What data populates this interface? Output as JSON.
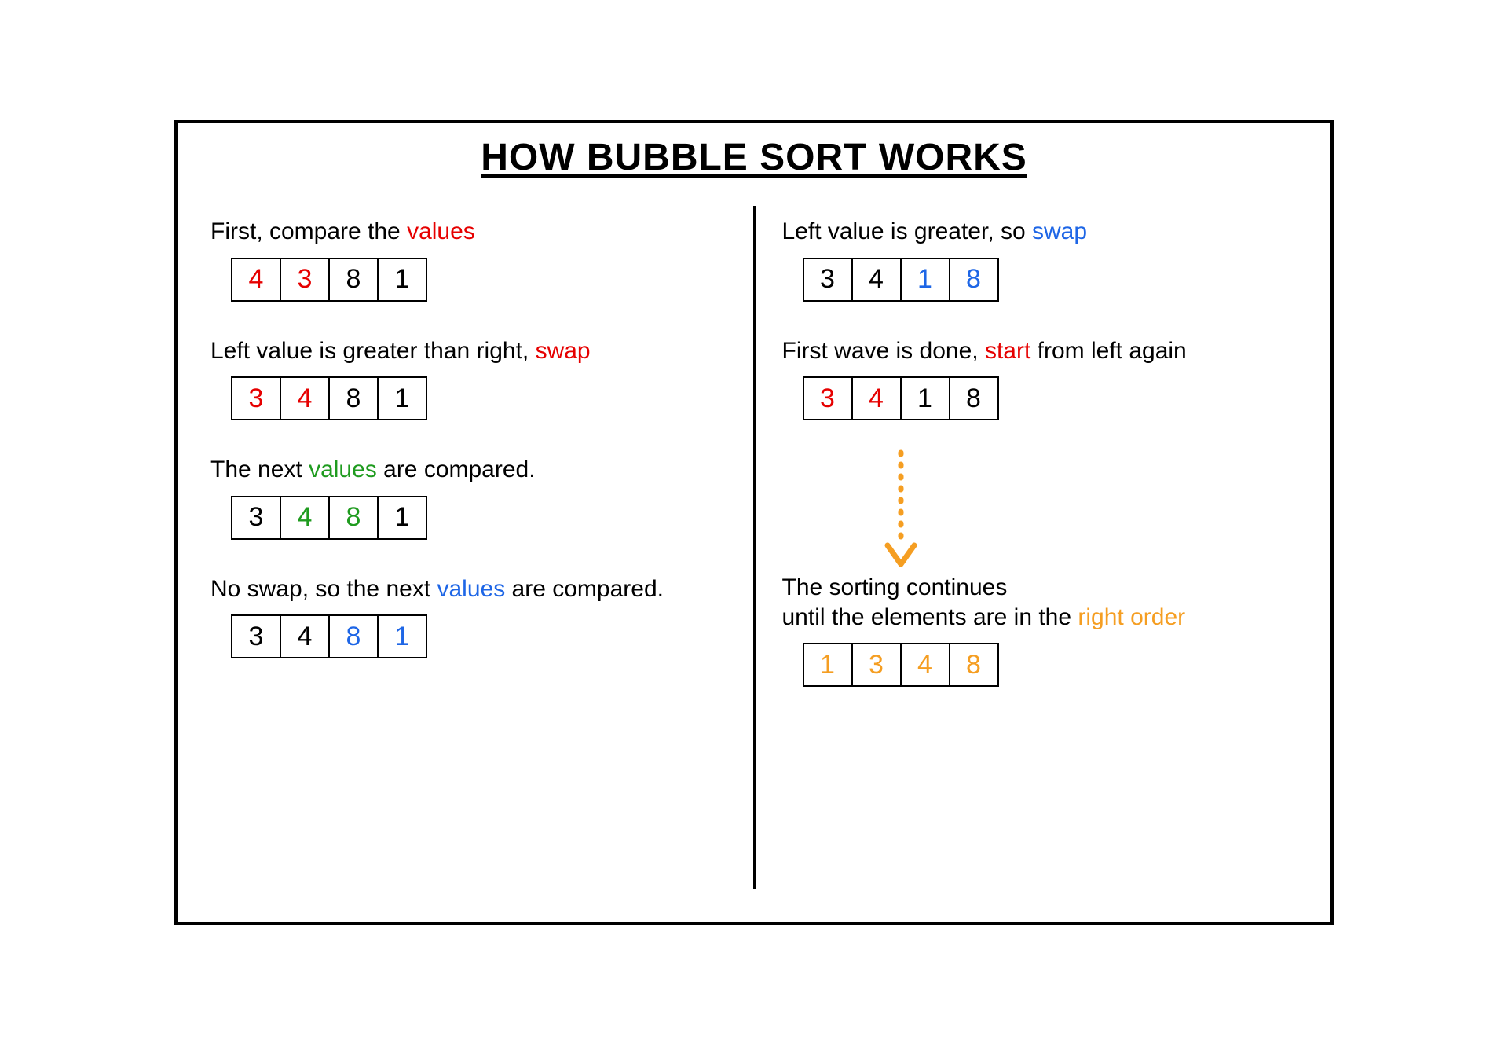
{
  "title": "HOW BUBBLE SORT WORKS",
  "colors": {
    "red": "#e60000",
    "green": "#1f9b1f",
    "blue": "#1e66e6",
    "orange": "#f59e22"
  },
  "left": [
    {
      "id": "step1",
      "caption": [
        {
          "text": "First, compare the "
        },
        {
          "text": "values",
          "color": "red"
        }
      ],
      "cells": [
        {
          "v": "4",
          "color": "red"
        },
        {
          "v": "3",
          "color": "red"
        },
        {
          "v": "8"
        },
        {
          "v": "1"
        }
      ]
    },
    {
      "id": "step2",
      "caption": [
        {
          "text": "Left value is greater than right, "
        },
        {
          "text": "swap",
          "color": "red"
        }
      ],
      "cells": [
        {
          "v": "3",
          "color": "red"
        },
        {
          "v": "4",
          "color": "red"
        },
        {
          "v": "8"
        },
        {
          "v": "1"
        }
      ]
    },
    {
      "id": "step3",
      "caption": [
        {
          "text": "The next "
        },
        {
          "text": "values",
          "color": "green"
        },
        {
          "text": " are compared."
        }
      ],
      "cells": [
        {
          "v": "3"
        },
        {
          "v": "4",
          "color": "green"
        },
        {
          "v": "8",
          "color": "green"
        },
        {
          "v": "1"
        }
      ]
    },
    {
      "id": "step4",
      "caption": [
        {
          "text": "No swap, so the next "
        },
        {
          "text": "values",
          "color": "blue"
        },
        {
          "text": " are compared."
        }
      ],
      "cells": [
        {
          "v": "3"
        },
        {
          "v": "4"
        },
        {
          "v": "8",
          "color": "blue"
        },
        {
          "v": "1",
          "color": "blue"
        }
      ]
    }
  ],
  "right": [
    {
      "id": "step5",
      "caption": [
        {
          "text": "Left value is greater, so "
        },
        {
          "text": "swap",
          "color": "blue"
        }
      ],
      "cells": [
        {
          "v": "3"
        },
        {
          "v": "4"
        },
        {
          "v": "1",
          "color": "blue"
        },
        {
          "v": "8",
          "color": "blue"
        }
      ]
    },
    {
      "id": "step6",
      "caption": [
        {
          "text": "First wave is done, "
        },
        {
          "text": "start",
          "color": "red"
        },
        {
          "text": " from left again"
        }
      ],
      "cells": [
        {
          "v": "3",
          "color": "red"
        },
        {
          "v": "4",
          "color": "red"
        },
        {
          "v": "1"
        },
        {
          "v": "8"
        }
      ],
      "arrowAfter": true
    },
    {
      "id": "step7",
      "caption": [
        {
          "text": "The sorting continues"
        },
        {
          "br": true
        },
        {
          "text": "until the elements are in the "
        },
        {
          "text": "right order",
          "color": "orange"
        }
      ],
      "cells": [
        {
          "v": "1",
          "color": "orange"
        },
        {
          "v": "3",
          "color": "orange"
        },
        {
          "v": "4",
          "color": "orange"
        },
        {
          "v": "8",
          "color": "orange"
        }
      ]
    }
  ]
}
